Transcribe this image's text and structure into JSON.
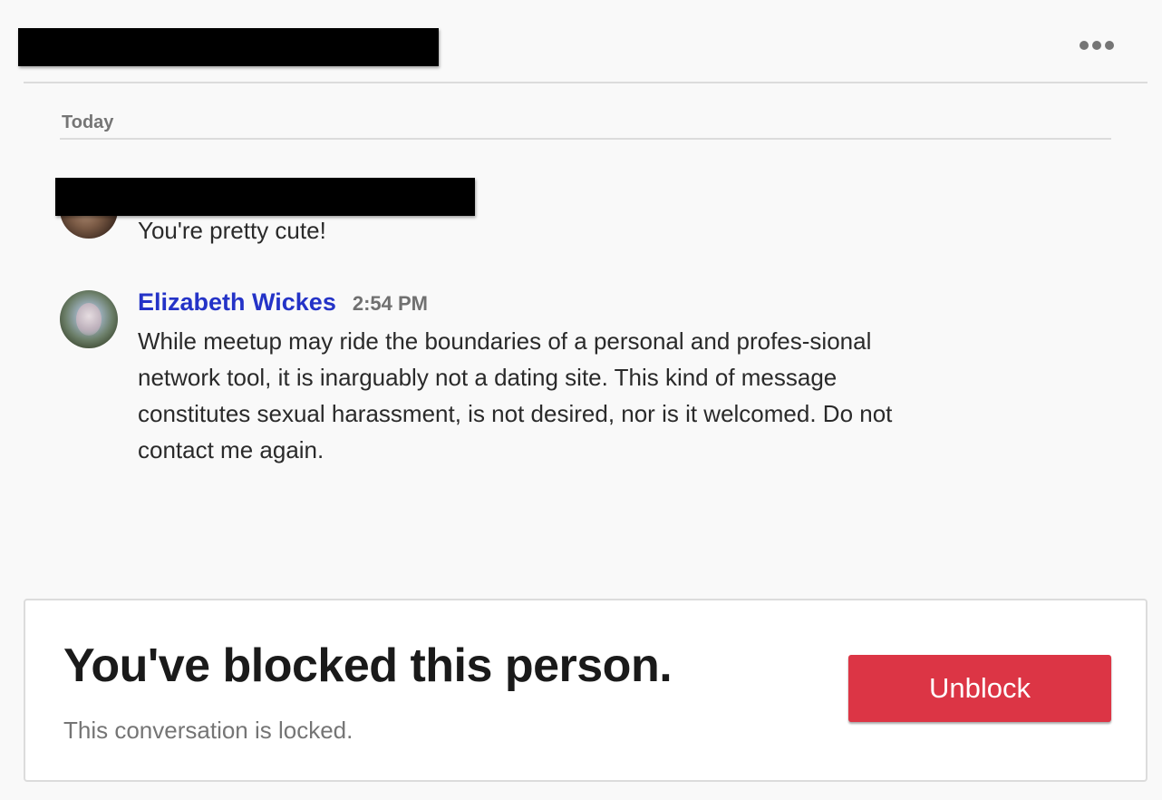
{
  "header": {
    "more_icon": "more-horizontal-icon"
  },
  "conversation": {
    "date_label": "Today",
    "messages": [
      {
        "sender": "",
        "time": "",
        "text": "You're pretty cute!"
      },
      {
        "sender": "Elizabeth Wickes",
        "time": "2:54 PM",
        "text": "While meetup may ride the boundaries of a personal and profes-sional network tool, it is inarguably not a dating site. This kind of message constitutes sexual harassment, is not desired, nor is it welcomed. Do not contact me again."
      }
    ]
  },
  "blocked": {
    "title": "You've blocked this person.",
    "subtitle": "This conversation is locked.",
    "unblock_label": "Unblock"
  },
  "colors": {
    "accent_red": "#dc3545",
    "author_link": "#2433c7",
    "background": "#f9f9f9"
  }
}
